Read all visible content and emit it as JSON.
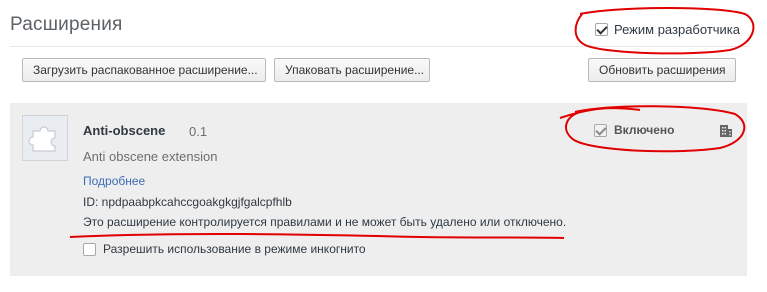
{
  "page": {
    "title": "Расширения"
  },
  "developer_mode": {
    "label": "Режим разработчика",
    "checked": true
  },
  "toolbar": {
    "load_unpacked_label": "Загрузить распакованное расширение...",
    "pack_label": "Упаковать расширение...",
    "update_label": "Обновить расширения"
  },
  "extension": {
    "name": "Anti-obscene",
    "version": "0.1",
    "description": "Anti obscene extension",
    "details_link": "Подробнее",
    "id_text": "ID: npdpaabpkcahccgoakgkgjfgalcpfhlb",
    "policy_text": "Это расширение контролируется правилами и не может быть удалено или отключено.",
    "enabled_label": "Включено",
    "enabled_checked": true,
    "incognito_label": "Разрешить использование в режиме инкогнито",
    "incognito_checked": false,
    "icon": "puzzle-piece-icon",
    "policy_icon": "building-icon"
  },
  "annotation_color": "#e00000"
}
